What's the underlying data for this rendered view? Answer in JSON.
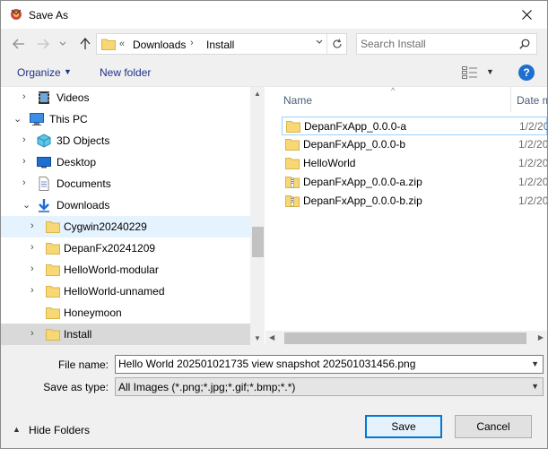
{
  "window": {
    "title": "Save As"
  },
  "address": {
    "overflow": "«",
    "segments": [
      "Downloads",
      "Install"
    ],
    "search_placeholder": "Search Install"
  },
  "toolbar": {
    "organize_label": "Organize",
    "new_folder_label": "New folder",
    "help_label": "?"
  },
  "nav": {
    "items": [
      {
        "label": "Videos",
        "icon": "video-folder-icon"
      },
      {
        "label": "This PC",
        "icon": "computer-icon"
      },
      {
        "label": "3D Objects",
        "icon": "3d-objects-icon"
      },
      {
        "label": "Desktop",
        "icon": "desktop-icon"
      },
      {
        "label": "Documents",
        "icon": "documents-icon"
      },
      {
        "label": "Downloads",
        "icon": "downloads-icon"
      },
      {
        "label": "Cygwin20240229",
        "icon": "folder-icon"
      },
      {
        "label": "DepanFx20241209",
        "icon": "folder-icon"
      },
      {
        "label": "HelloWorld-modular",
        "icon": "folder-icon"
      },
      {
        "label": "HelloWorld-unnamed",
        "icon": "folder-icon"
      },
      {
        "label": "Honeymoon",
        "icon": "folder-icon"
      },
      {
        "label": "Install",
        "icon": "folder-icon"
      }
    ]
  },
  "files": {
    "col_name": "Name",
    "col_date": "Date m",
    "rows": [
      {
        "name": "DepanFxApp_0.0.0-a",
        "date": "1/2/20",
        "icon": "folder-icon"
      },
      {
        "name": "DepanFxApp_0.0.0-b",
        "date": "1/2/20",
        "icon": "folder-icon"
      },
      {
        "name": "HelloWorld",
        "date": "1/2/20",
        "icon": "folder-icon"
      },
      {
        "name": "DepanFxApp_0.0.0-a.zip",
        "date": "1/2/20",
        "icon": "zip-folder-icon"
      },
      {
        "name": "DepanFxApp_0.0.0-b.zip",
        "date": "1/2/20",
        "icon": "zip-folder-icon"
      }
    ]
  },
  "form": {
    "file_name_label": "File name:",
    "file_name_value": "Hello World 202501021735 view snapshot 202501031456.png",
    "save_type_label": "Save as type:",
    "save_type_value": "All Images (*.png;*.jpg;*.gif;*.bmp;*.*)"
  },
  "footer": {
    "hide_folders_label": "Hide Folders",
    "save_label": "Save",
    "cancel_label": "Cancel"
  },
  "colors": {
    "accent": "#0078d7",
    "link": "#1e3287",
    "selection": "#cce8ff",
    "folder": "#f8d775"
  }
}
